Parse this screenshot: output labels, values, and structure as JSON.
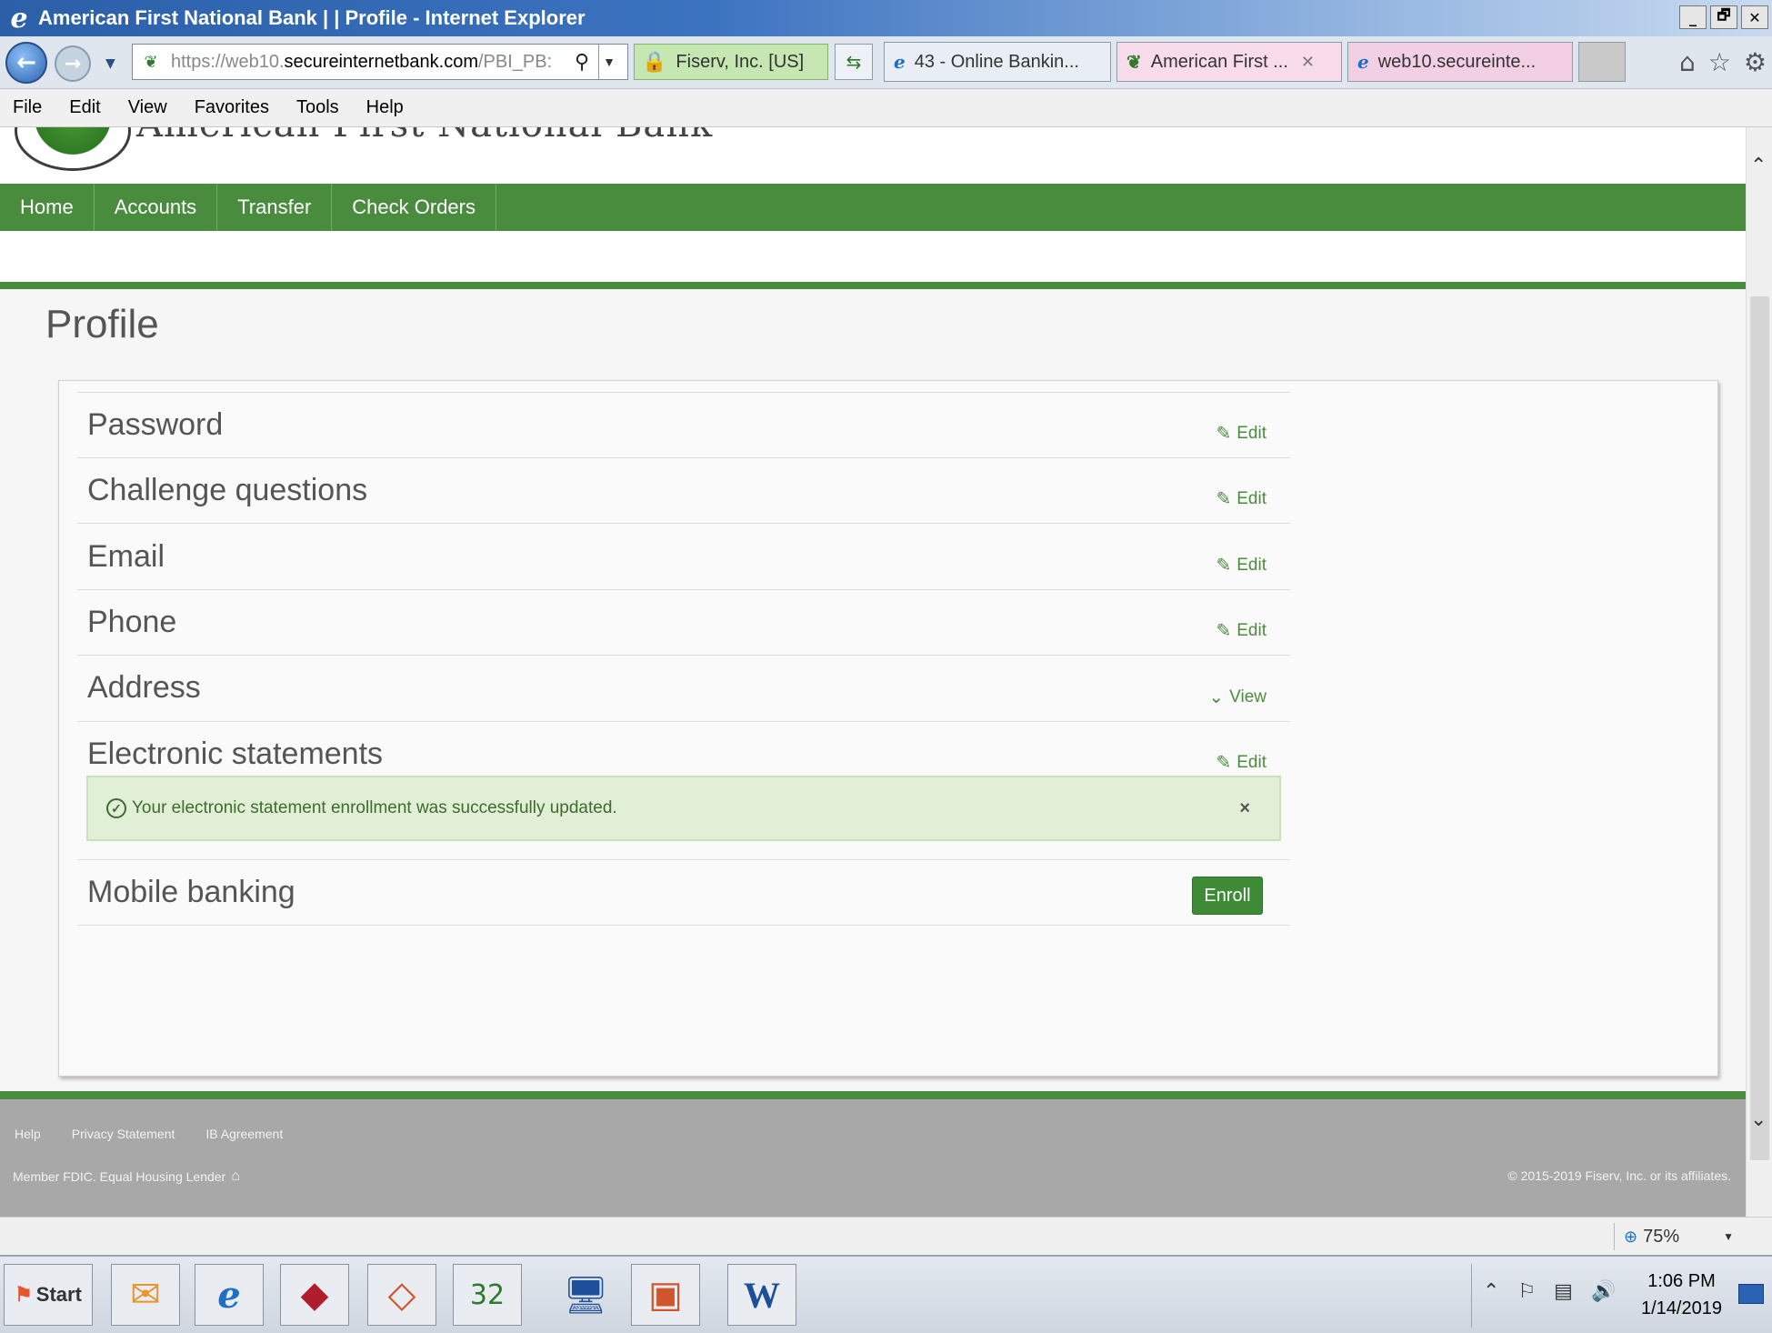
{
  "window": {
    "title": "American First National Bank |  | Profile - Internet Explorer",
    "controls": [
      "_",
      "🗗",
      "✕"
    ]
  },
  "address_bar": {
    "url_prefix": "https://",
    "url_host_dim": "web10.",
    "url_host": "secureinternetbank.com",
    "url_path": "/PBI_PB:",
    "certificate": "Fiserv, Inc. [US]"
  },
  "tabs": [
    {
      "label": "43 - Online Bankin..."
    },
    {
      "label": "American First ..."
    },
    {
      "label": "web10.secureinte..."
    }
  ],
  "menu": [
    "File",
    "Edit",
    "View",
    "Favorites",
    "Tools",
    "Help"
  ],
  "site": {
    "bank_name": "American First National Bank",
    "nav": [
      "Home",
      "Accounts",
      "Transfer",
      "Check Orders"
    ]
  },
  "page": {
    "title": "Profile",
    "rows": [
      {
        "label": "Password",
        "action": "Edit"
      },
      {
        "label": "Challenge questions",
        "action": "Edit"
      },
      {
        "label": "Email",
        "action": "Edit"
      },
      {
        "label": "Phone",
        "action": "Edit"
      },
      {
        "label": "Address",
        "action": "View"
      },
      {
        "label": "Electronic statements",
        "action": "Edit"
      },
      {
        "label": "Mobile banking",
        "action": "Enroll"
      }
    ],
    "alert": {
      "message": "Your electronic statement enrollment was successfully updated.",
      "close": "×"
    }
  },
  "footer": {
    "links": [
      "Help",
      "Privacy Statement",
      "IB Agreement"
    ],
    "member": "Member FDIC. Equal Housing Lender",
    "copyright": "© 2015-2019 Fiserv, Inc. or its affiliates."
  },
  "status": {
    "zoom": "75%"
  },
  "taskbar": {
    "start": "Start",
    "time": "1:06 PM",
    "date": "1/14/2019",
    "badge": "32"
  },
  "colors": {
    "brand_green": "#4a8c3e",
    "alert_bg": "#e0efd6",
    "footer_gray": "#a8a8a8"
  }
}
